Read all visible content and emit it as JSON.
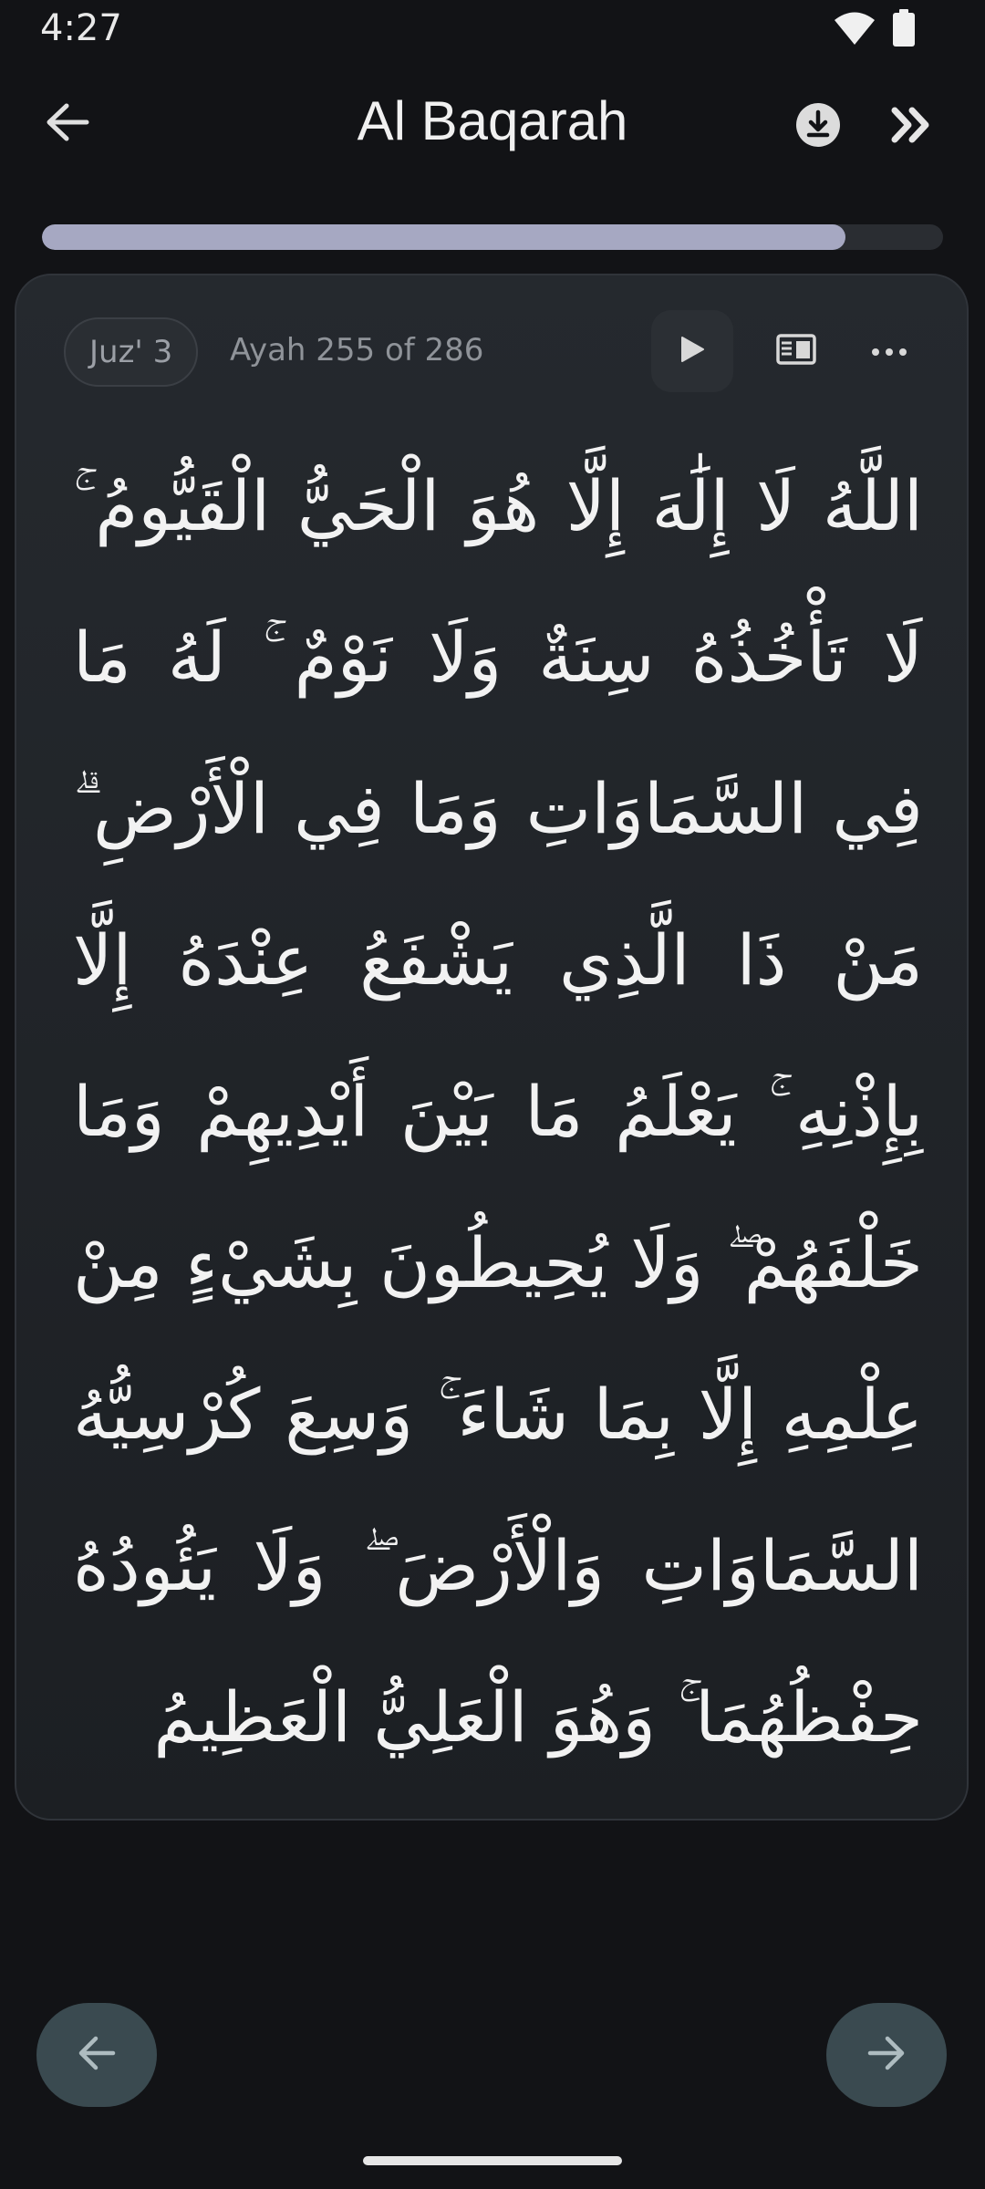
{
  "status_bar": {
    "time": "4:27",
    "icons": [
      "wifi-icon",
      "battery-icon"
    ]
  },
  "app_bar": {
    "title": "Al Baqarah",
    "icons": [
      "arrow-left-icon",
      "download-icon",
      "double-chevron-right-icon"
    ]
  },
  "progress": {
    "fraction": 0.8916
  },
  "ayah_card": {
    "juz_label": "Juz' 3",
    "ayah_counter": "Ayah 255 of 286",
    "controls": [
      "play-icon",
      "reader-mode-icon",
      "more-horizontal-icon"
    ],
    "arabic_text": "اللَّهُ لَا إِلَٰهَ إِلَّا هُوَ الْحَيُّ الْقَيُّومُ ۚ لَا تَأْخُذُهُ سِنَةٌ وَلَا نَوْمٌ ۚ لَهُ مَا فِي السَّمَاوَاتِ وَمَا فِي الْأَرْضِ ۗ مَنْ ذَا الَّذِي يَشْفَعُ عِنْدَهُ إِلَّا بِإِذْنِهِ ۚ يَعْلَمُ مَا بَيْنَ أَيْدِيهِمْ وَمَا خَلْفَهُمْ ۖ وَلَا يُحِيطُونَ بِشَيْءٍ مِنْ عِلْمِهِ إِلَّا بِمَا شَاءَ ۚ وَسِعَ كُرْسِيُّهُ السَّمَاوَاتِ وَالْأَرْضَ ۖ وَلَا يَئُودُهُ حِفْظُهُمَا ۚ وَهُوَ الْعَلِيُّ الْعَظِيمُ"
  },
  "navigation": {
    "icons": [
      "arrow-left-icon",
      "arrow-right-icon"
    ]
  },
  "colors": {
    "background": "#121316",
    "card": "#22262b",
    "progress_fill": "#a6a8c2",
    "nav_button": "#3a4a50"
  }
}
